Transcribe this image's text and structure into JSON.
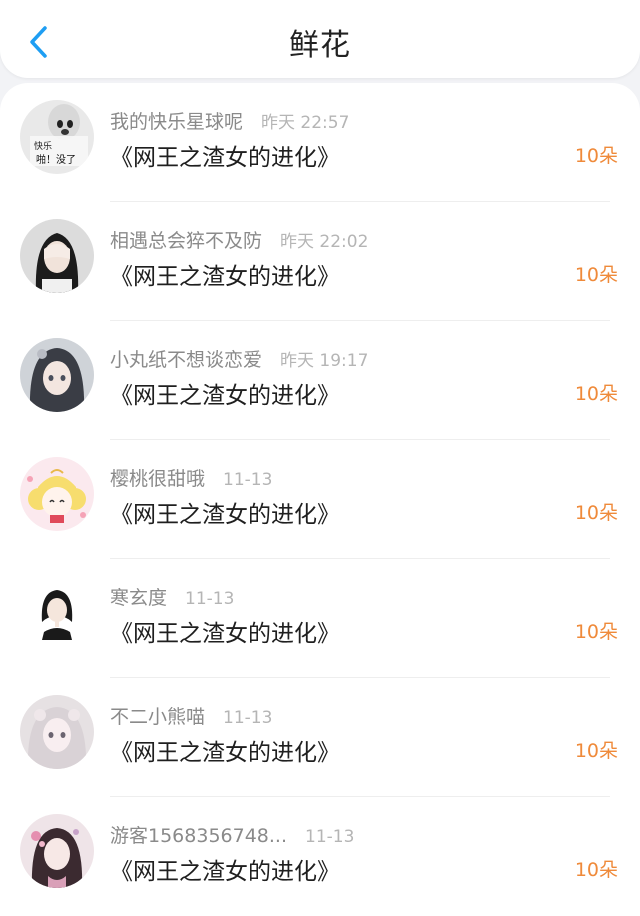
{
  "header": {
    "title": "鲜花",
    "back_icon": "chevron-left-icon",
    "accent_color": "#1e9ef3"
  },
  "records": [
    {
      "name": "我的快乐星球呢",
      "time": "昨天 22:57",
      "book": "《网王之渣女的进化》",
      "amount": "10朵",
      "avatar_text": [
        "快乐",
        "啪！没了"
      ]
    },
    {
      "name": "相遇总会猝不及防",
      "time": "昨天 22:02",
      "book": "《网王之渣女的进化》",
      "amount": "10朵"
    },
    {
      "name": "小丸纸不想谈恋爱",
      "time": "昨天 19:17",
      "book": "《网王之渣女的进化》",
      "amount": "10朵"
    },
    {
      "name": "樱桃很甜哦",
      "time": "11-13",
      "book": "《网王之渣女的进化》",
      "amount": "10朵"
    },
    {
      "name": "寒玄度",
      "time": "11-13",
      "book": "《网王之渣女的进化》",
      "amount": "10朵"
    },
    {
      "name": "不二小熊喵",
      "time": "11-13",
      "book": "《网王之渣女的进化》",
      "amount": "10朵"
    },
    {
      "name": "游客1568356748...",
      "time": "11-13",
      "book": "《网王之渣女的进化》",
      "amount": "10朵"
    }
  ],
  "colors": {
    "amount": "#ef8a3a",
    "name": "#8a8a8a",
    "time": "#b5b5b5",
    "background": "#f2f3f6"
  }
}
